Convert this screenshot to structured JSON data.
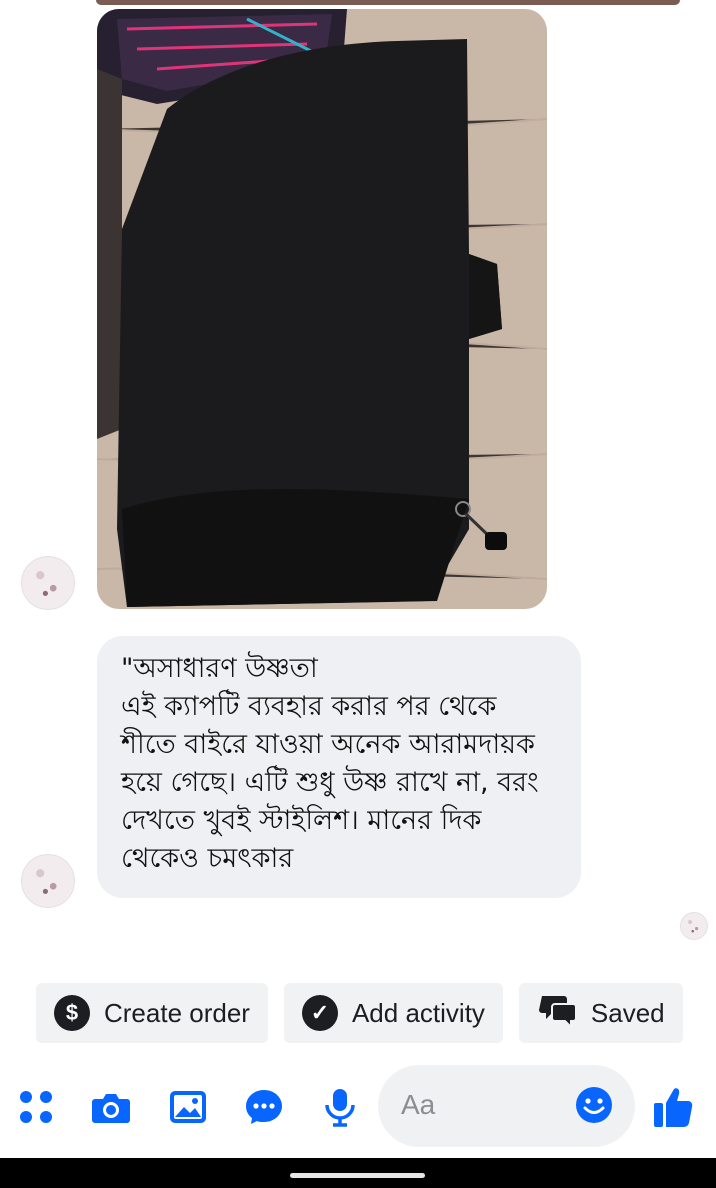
{
  "messages": {
    "image_alt": "black hood cap photo",
    "text": "\"অসাধারণ উষ্ণতা\nএই ক্যাপটি ব্যবহার করার পর থেকে শীতে বাইরে যাওয়া অনেক আরামদায়ক হয়ে গেছে। এটি শুধু উষ্ণ রাখে না, বরং দেখতে খুবই স্টাইলিশ। মানের দিক থেকেও চমৎকার"
  },
  "quick_actions": {
    "create_order": "Create order",
    "add_activity": "Add activity",
    "saved": "Saved"
  },
  "composer": {
    "placeholder": "Aa"
  },
  "colors": {
    "accent": "#0866ff",
    "bubble": "#eff0f3",
    "chip": "#f1f2f4"
  },
  "icons": [
    "menu-dots-icon",
    "camera-icon",
    "gallery-icon",
    "chat-icon",
    "mic-icon",
    "emoji-icon",
    "like-icon",
    "dollar-icon",
    "check-icon",
    "saved-replies-icon"
  ]
}
